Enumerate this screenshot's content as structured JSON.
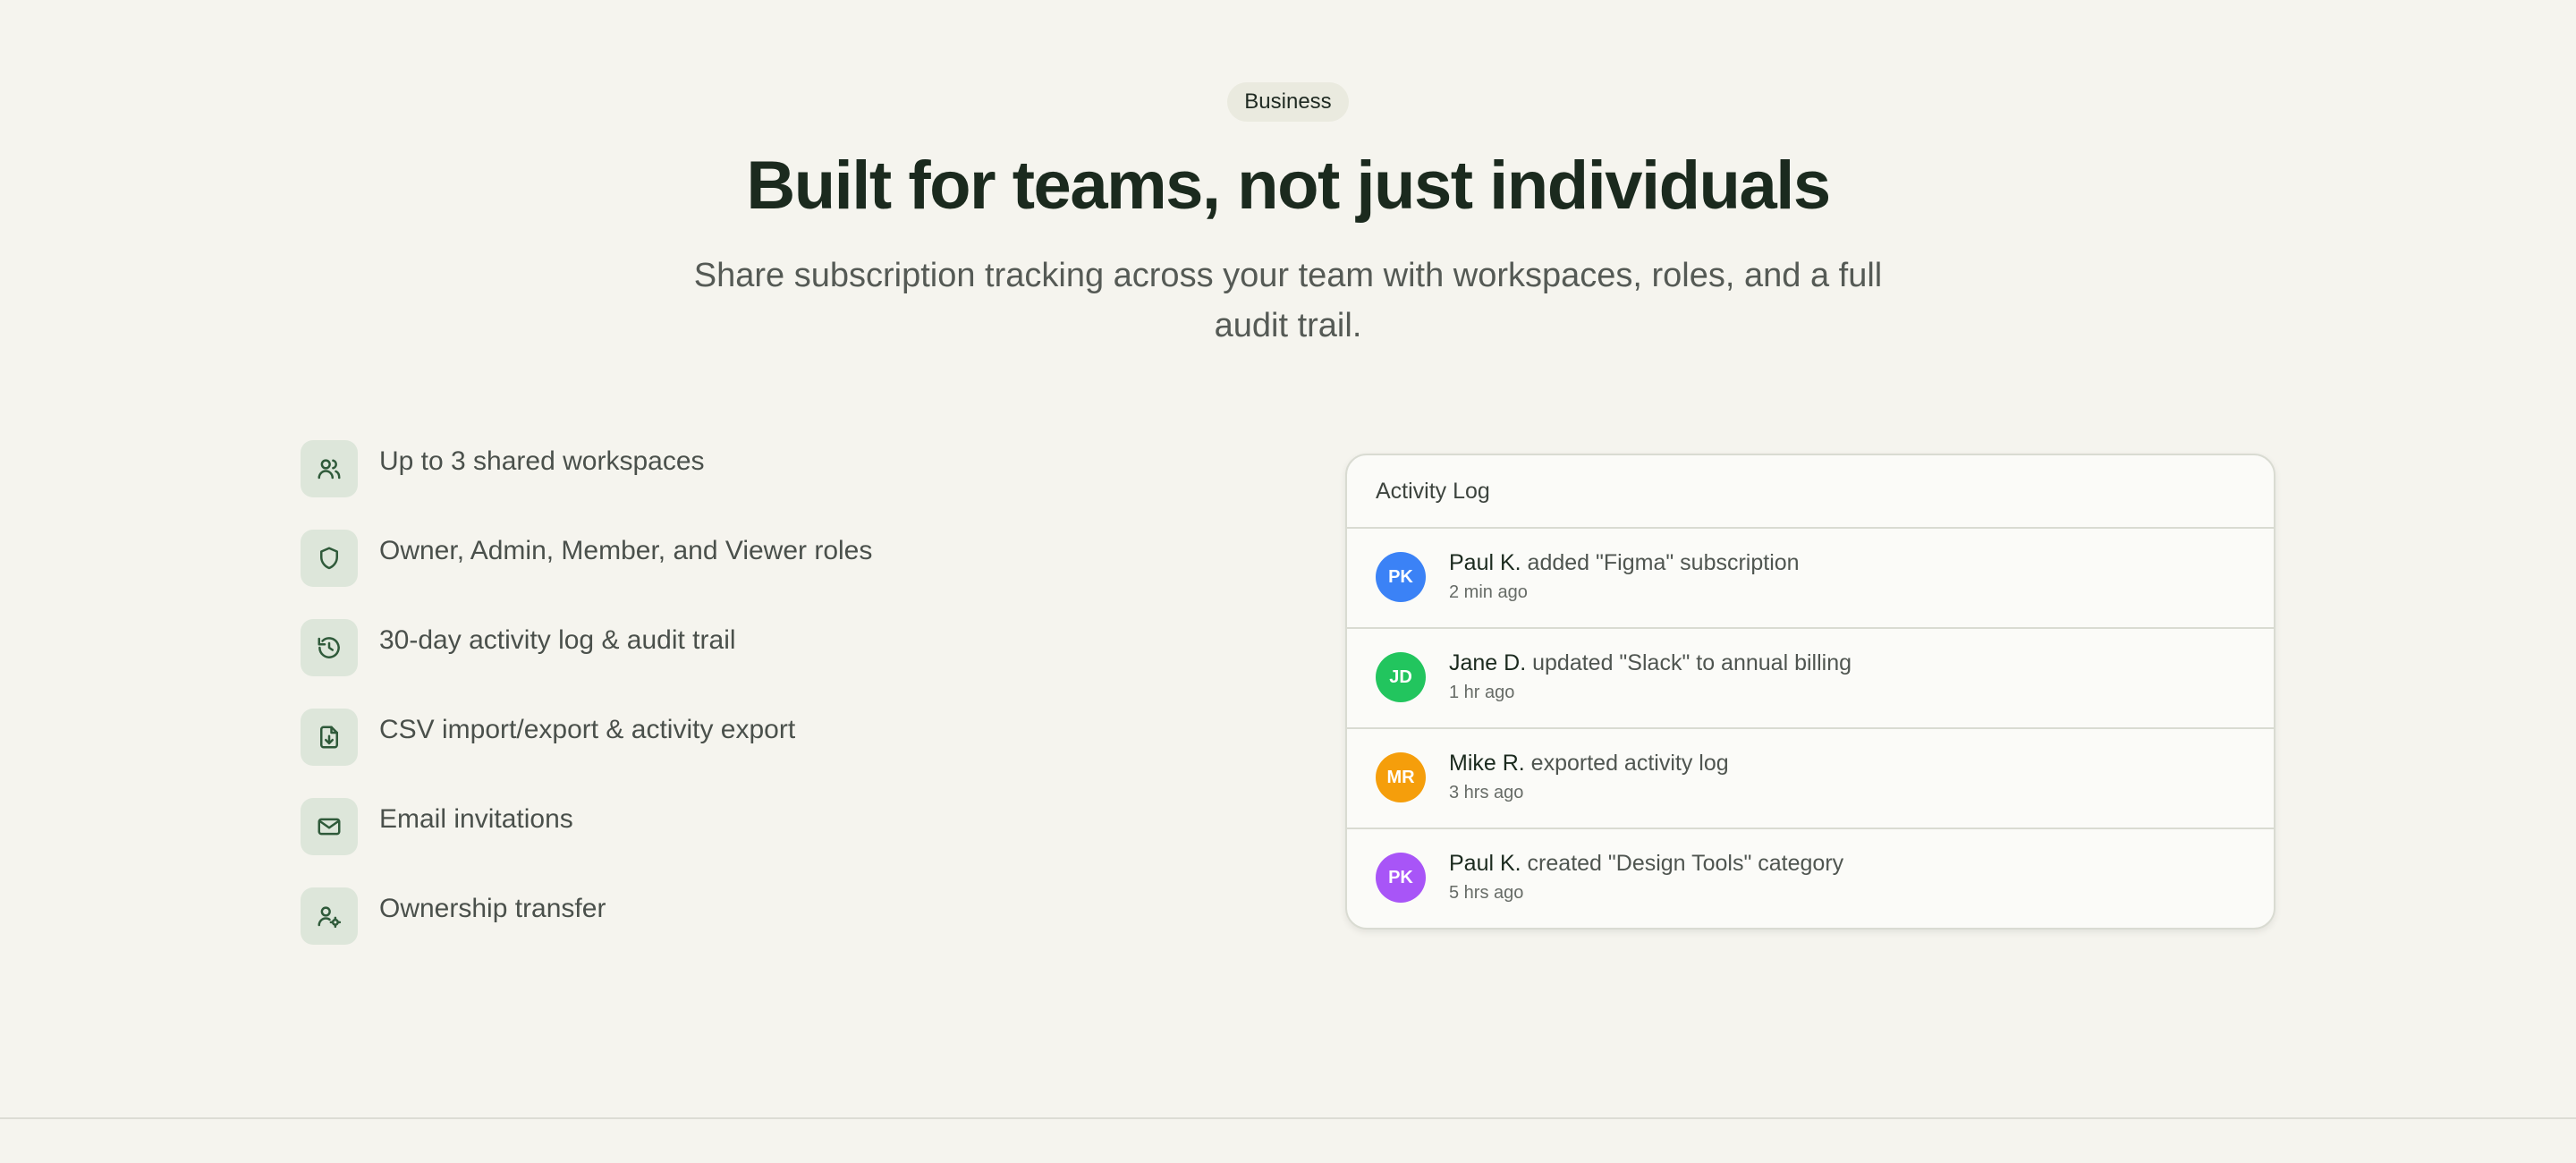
{
  "badge": "Business",
  "title": "Built for teams, not just individuals",
  "subtitle": "Share subscription tracking across your team with workspaces, roles, and a full audit trail.",
  "features": [
    {
      "label": "Up to 3 shared workspaces",
      "icon": "users-icon"
    },
    {
      "label": "Owner, Admin, Member, and Viewer roles",
      "icon": "shield-icon"
    },
    {
      "label": "30-day activity log & audit trail",
      "icon": "history-icon"
    },
    {
      "label": "CSV import/export & activity export",
      "icon": "file-download-icon"
    },
    {
      "label": "Email invitations",
      "icon": "mail-icon"
    },
    {
      "label": "Ownership transfer",
      "icon": "user-cog-icon"
    }
  ],
  "activity": {
    "title": "Activity Log",
    "entries": [
      {
        "initials": "PK",
        "name": "Paul K.",
        "action": " added \"Figma\" subscription",
        "time": "2 min ago",
        "color": "#3b82f6"
      },
      {
        "initials": "JD",
        "name": "Jane D.",
        "action": " updated \"Slack\" to annual billing",
        "time": "1 hr ago",
        "color": "#22c55e"
      },
      {
        "initials": "MR",
        "name": "Mike R.",
        "action": " exported activity log",
        "time": "3 hrs ago",
        "color": "#f59e0b"
      },
      {
        "initials": "PK",
        "name": "Paul K.",
        "action": " created \"Design Tools\" category",
        "time": "5 hrs ago",
        "color": "#a855f7"
      }
    ]
  }
}
